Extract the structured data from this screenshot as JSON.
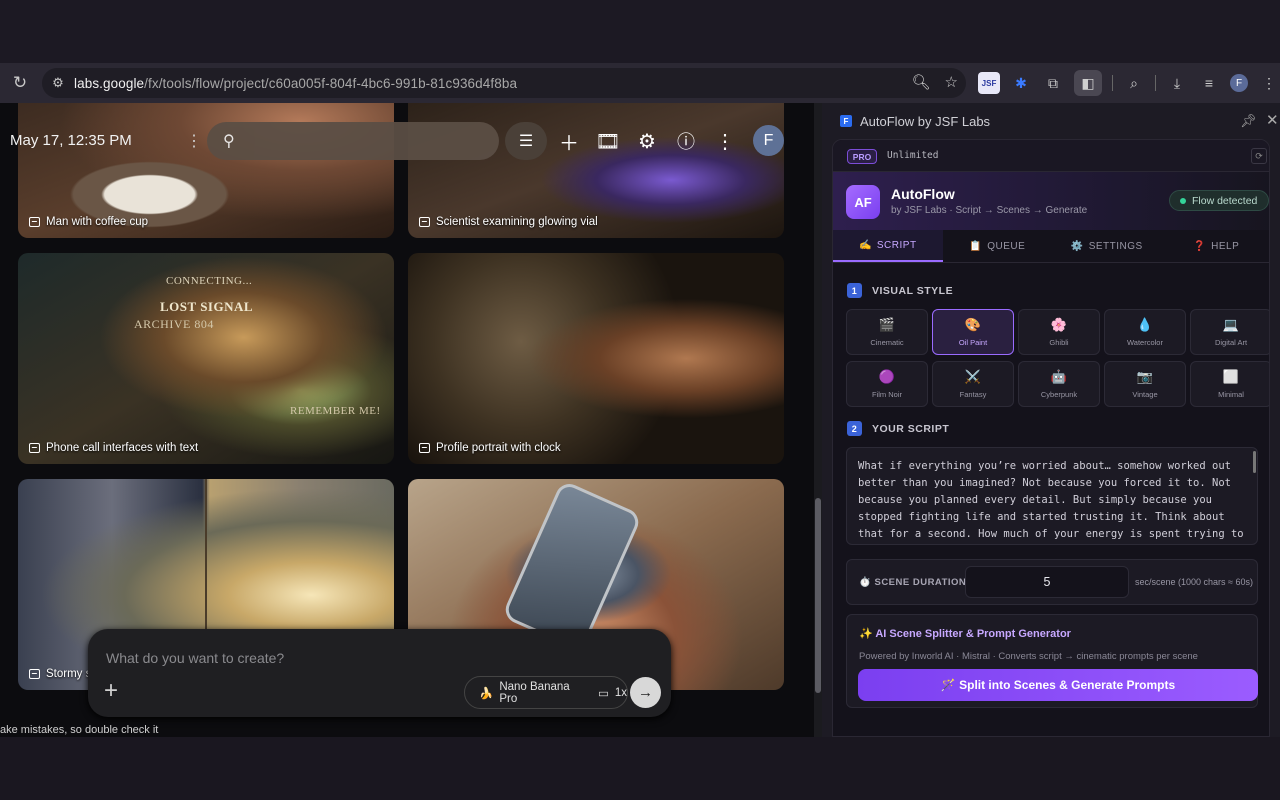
{
  "browser": {
    "url_host": "labs.google",
    "url_path": "/fx/tools/flow/project/c60a005f-804f-4bc6-991b-81c936d4f8ba",
    "profile_initial": "F"
  },
  "flow": {
    "datetime": "May 17, 12:35 PM",
    "profile_initial": "F",
    "cards": [
      {
        "label": "Man with coffee cup"
      },
      {
        "label": "Scientist examining glowing vial"
      },
      {
        "label": "Phone call interfaces with text"
      },
      {
        "label": "Profile portrait with clock"
      },
      {
        "label": "Stormy s"
      },
      {
        "label": ""
      }
    ],
    "scene_text": {
      "connecting": "CONNECTING...",
      "lost_signal": "LOST SIGNAL",
      "archive": "ARCHIVE 804",
      "remember": "REMEMBER ME!"
    },
    "composer": {
      "placeholder": "What do you want to create?",
      "model": "Nano Banana Pro",
      "count": "1x"
    },
    "disclaimer": "ake mistakes, so double check it"
  },
  "sidebar": {
    "title": "AutoFlow by JSF Labs",
    "pro_badge": "PRO",
    "plan": "Unlimited",
    "brand_logo": "AF",
    "brand_name": "AutoFlow",
    "brand_sub": "by JSF Labs · Script → Scenes → Generate",
    "status": "Flow detected",
    "tabs": [
      {
        "icon": "✍️",
        "label": "SCRIPT"
      },
      {
        "icon": "📋",
        "label": "QUEUE"
      },
      {
        "icon": "⚙️",
        "label": "SETTINGS"
      },
      {
        "icon": "❓",
        "label": "HELP"
      }
    ],
    "visual_style": {
      "number": "1",
      "heading": "VISUAL STYLE",
      "options": [
        {
          "icon": "🎬",
          "label": "Cinematic"
        },
        {
          "icon": "🎨",
          "label": "Oil Paint"
        },
        {
          "icon": "🌸",
          "label": "Ghibli"
        },
        {
          "icon": "💧",
          "label": "Watercolor"
        },
        {
          "icon": "💻",
          "label": "Digital Art"
        },
        {
          "icon": "🟣",
          "label": "Film Noir"
        },
        {
          "icon": "⚔️",
          "label": "Fantasy"
        },
        {
          "icon": "🤖",
          "label": "Cyberpunk"
        },
        {
          "icon": "📷",
          "label": "Vintage"
        },
        {
          "icon": "⬜",
          "label": "Minimal"
        }
      ],
      "selected": "Oil Paint"
    },
    "script": {
      "number": "2",
      "heading": "YOUR SCRIPT",
      "value": "What if everything you’re worried about… somehow worked out better than you imagined? Not because you forced it to. Not because you planned every detail. But simply because you stopped fighting life and started trusting it. Think about that for a second. How much of your energy is spent trying to"
    },
    "duration": {
      "icon": "⏱️",
      "label": "SCENE DURATION",
      "value": "5",
      "unit": "sec/scene (1000 chars ≈ 60s)"
    },
    "ai": {
      "title": "✨ AI Scene Splitter & Prompt Generator",
      "desc": "Powered by Inworld AI · Mistral · Converts script → cinematic prompts per scene",
      "button": "🪄 Split into Scenes & Generate Prompts"
    }
  }
}
